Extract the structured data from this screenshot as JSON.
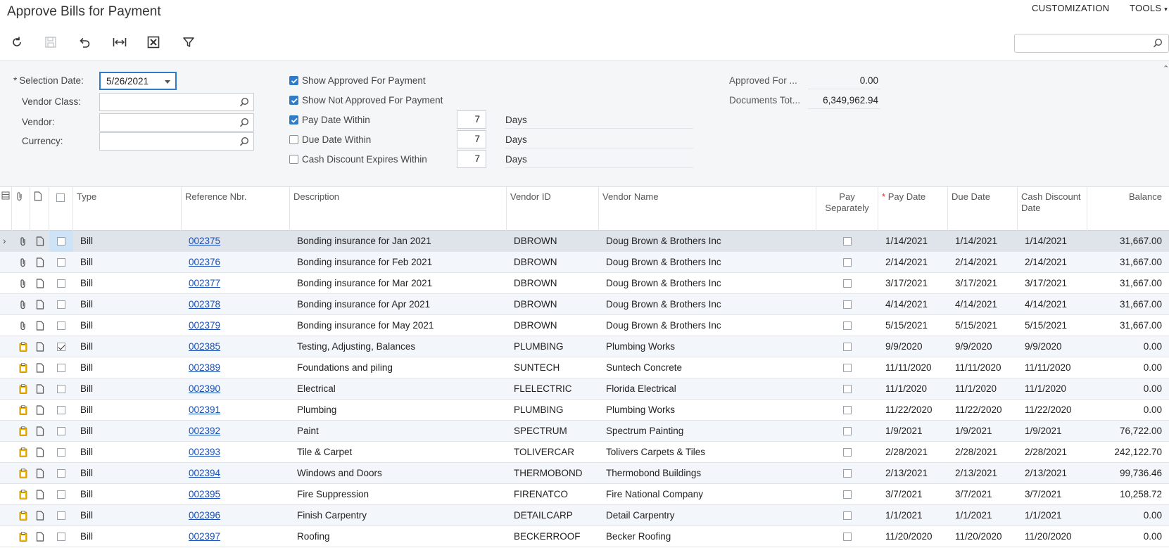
{
  "header": {
    "title": "Approve Bills for Payment",
    "menu_customization": "CUSTOMIZATION",
    "menu_tools": "TOOLS"
  },
  "toolbar": {
    "icons": [
      "refresh-icon",
      "save-icon",
      "undo-icon",
      "fit-columns-icon",
      "export-excel-icon",
      "filter-icon"
    ],
    "search_value": ""
  },
  "filter": {
    "selection_date_label": "Selection Date:",
    "selection_date_value": "5/26/2021",
    "vendor_class_label": "Vendor Class:",
    "vendor_label": "Vendor:",
    "currency_label": "Currency:",
    "show_approved_label": "Show Approved For Payment",
    "show_approved_checked": true,
    "show_not_approved_label": "Show Not Approved For Payment",
    "show_not_approved_checked": true,
    "pay_date_within_label": "Pay Date Within",
    "pay_date_within_checked": true,
    "pay_date_within_value": "7",
    "due_date_within_label": "Due Date Within",
    "due_date_within_checked": false,
    "due_date_within_value": "7",
    "cash_discount_label": "Cash Discount Expires Within",
    "cash_discount_checked": false,
    "cash_discount_value": "7",
    "days_label": "Days",
    "approved_for_label": "Approved For ...",
    "approved_for_value": "0.00",
    "documents_total_label": "Documents Tot...",
    "documents_total_value": "6,349,962.94"
  },
  "grid": {
    "columns": {
      "type": "Type",
      "ref": "Reference Nbr.",
      "description": "Description",
      "vendor_id": "Vendor ID",
      "vendor_name": "Vendor Name",
      "pay_separately": "Pay Separately",
      "pay_date": "Pay Date",
      "due_date": "Due Date",
      "cash_discount_date": "Cash Discount Date",
      "balance": "Balance"
    },
    "rows": [
      {
        "icon": "paperclip",
        "selected": false,
        "type": "Bill",
        "ref": "002375",
        "description": "Bonding insurance for Jan 2021",
        "vendor_id": "DBROWN",
        "vendor_name": "Doug Brown & Brothers Inc",
        "pay_date": "1/14/2021",
        "due_date": "1/14/2021",
        "cash_discount_date": "1/14/2021",
        "balance": "31,667.00"
      },
      {
        "icon": "paperclip",
        "selected": false,
        "type": "Bill",
        "ref": "002376",
        "description": "Bonding insurance for Feb 2021",
        "vendor_id": "DBROWN",
        "vendor_name": "Doug Brown & Brothers Inc",
        "pay_date": "2/14/2021",
        "due_date": "2/14/2021",
        "cash_discount_date": "2/14/2021",
        "balance": "31,667.00"
      },
      {
        "icon": "paperclip",
        "selected": false,
        "type": "Bill",
        "ref": "002377",
        "description": "Bonding insurance for Mar 2021",
        "vendor_id": "DBROWN",
        "vendor_name": "Doug Brown & Brothers Inc",
        "pay_date": "3/17/2021",
        "due_date": "3/17/2021",
        "cash_discount_date": "3/17/2021",
        "balance": "31,667.00"
      },
      {
        "icon": "paperclip",
        "selected": false,
        "type": "Bill",
        "ref": "002378",
        "description": "Bonding insurance for Apr 2021",
        "vendor_id": "DBROWN",
        "vendor_name": "Doug Brown & Brothers Inc",
        "pay_date": "4/14/2021",
        "due_date": "4/14/2021",
        "cash_discount_date": "4/14/2021",
        "balance": "31,667.00"
      },
      {
        "icon": "paperclip",
        "selected": false,
        "type": "Bill",
        "ref": "002379",
        "description": "Bonding insurance for May 2021",
        "vendor_id": "DBROWN",
        "vendor_name": "Doug Brown & Brothers Inc",
        "pay_date": "5/15/2021",
        "due_date": "5/15/2021",
        "cash_discount_date": "5/15/2021",
        "balance": "31,667.00"
      },
      {
        "icon": "clipboard",
        "selected": true,
        "type": "Bill",
        "ref": "002385",
        "description": "Testing, Adjusting, Balances",
        "vendor_id": "PLUMBING",
        "vendor_name": "Plumbing Works",
        "pay_date": "9/9/2020",
        "due_date": "9/9/2020",
        "cash_discount_date": "9/9/2020",
        "balance": "0.00"
      },
      {
        "icon": "clipboard",
        "selected": false,
        "type": "Bill",
        "ref": "002389",
        "description": "Foundations and piling",
        "vendor_id": "SUNTECH",
        "vendor_name": "Suntech Concrete",
        "pay_date": "11/11/2020",
        "due_date": "11/11/2020",
        "cash_discount_date": "11/11/2020",
        "balance": "0.00"
      },
      {
        "icon": "clipboard",
        "selected": false,
        "type": "Bill",
        "ref": "002390",
        "description": "Electrical",
        "vendor_id": "FLELECTRIC",
        "vendor_name": "Florida Electrical",
        "pay_date": "11/1/2020",
        "due_date": "11/1/2020",
        "cash_discount_date": "11/1/2020",
        "balance": "0.00"
      },
      {
        "icon": "clipboard",
        "selected": false,
        "type": "Bill",
        "ref": "002391",
        "description": "Plumbing",
        "vendor_id": "PLUMBING",
        "vendor_name": "Plumbing Works",
        "pay_date": "11/22/2020",
        "due_date": "11/22/2020",
        "cash_discount_date": "11/22/2020",
        "balance": "0.00"
      },
      {
        "icon": "clipboard",
        "selected": false,
        "type": "Bill",
        "ref": "002392",
        "description": "Paint",
        "vendor_id": "SPECTRUM",
        "vendor_name": "Spectrum Painting",
        "pay_date": "1/9/2021",
        "due_date": "1/9/2021",
        "cash_discount_date": "1/9/2021",
        "balance": "76,722.00"
      },
      {
        "icon": "clipboard",
        "selected": false,
        "type": "Bill",
        "ref": "002393",
        "description": "Tile & Carpet",
        "vendor_id": "TOLIVERCAR",
        "vendor_name": "Tolivers Carpets & Tiles",
        "pay_date": "2/28/2021",
        "due_date": "2/28/2021",
        "cash_discount_date": "2/28/2021",
        "balance": "242,122.70"
      },
      {
        "icon": "clipboard",
        "selected": false,
        "type": "Bill",
        "ref": "002394",
        "description": "Windows and Doors",
        "vendor_id": "THERMOBOND",
        "vendor_name": "Thermobond Buildings",
        "pay_date": "2/13/2021",
        "due_date": "2/13/2021",
        "cash_discount_date": "2/13/2021",
        "balance": "99,736.46"
      },
      {
        "icon": "clipboard",
        "selected": false,
        "type": "Bill",
        "ref": "002395",
        "description": "Fire Suppression",
        "vendor_id": "FIRENATCO",
        "vendor_name": "Fire National Company",
        "pay_date": "3/7/2021",
        "due_date": "3/7/2021",
        "cash_discount_date": "3/7/2021",
        "balance": "10,258.72"
      },
      {
        "icon": "clipboard",
        "selected": false,
        "type": "Bill",
        "ref": "002396",
        "description": "Finish Carpentry",
        "vendor_id": "DETAILCARP",
        "vendor_name": "Detail Carpentry",
        "pay_date": "1/1/2021",
        "due_date": "1/1/2021",
        "cash_discount_date": "1/1/2021",
        "balance": "0.00"
      },
      {
        "icon": "clipboard",
        "selected": false,
        "type": "Bill",
        "ref": "002397",
        "description": "Roofing",
        "vendor_id": "BECKERROOF",
        "vendor_name": "Becker Roofing",
        "pay_date": "11/20/2020",
        "due_date": "11/20/2020",
        "cash_discount_date": "11/20/2020",
        "balance": "0.00"
      }
    ]
  }
}
